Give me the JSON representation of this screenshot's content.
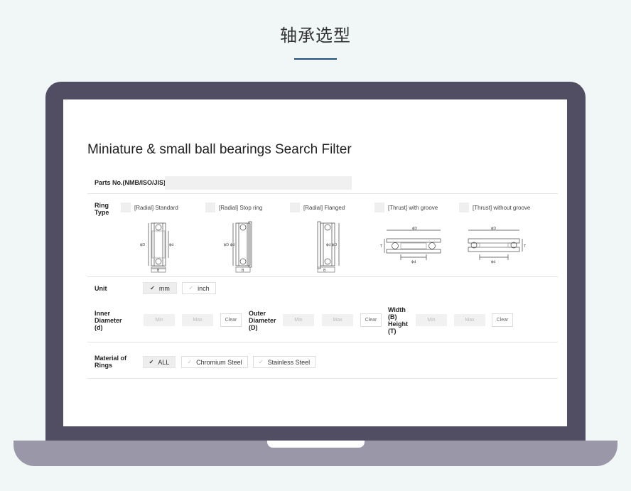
{
  "page_heading": "轴承选型",
  "filter": {
    "title": "Miniature & small ball bearings Search Filter",
    "parts_label": "Parts No.(NMB/ISO/JIS)",
    "parts_value": "",
    "ring_type_label": "Ring Type",
    "ring_types": [
      {
        "label": "[Radial] Standard",
        "icon": "radial-standard-bearing-diagram"
      },
      {
        "label": "[Radial] Stop ring",
        "icon": "radial-stop-ring-bearing-diagram"
      },
      {
        "label": "[Radial] Flanged",
        "icon": "radial-flanged-bearing-diagram"
      },
      {
        "label": "[Thrust] with groove",
        "icon": "thrust-with-groove-bearing-diagram"
      },
      {
        "label": "[Thrust] without groove",
        "icon": "thrust-without-groove-bearing-diagram"
      }
    ],
    "diagram_labels": {
      "phi_D": "ϕD",
      "phi_d": "ϕd",
      "phi_D_d": "ϕD ϕd",
      "phi_d_D": "ϕd ϕD",
      "B": "B",
      "T": "T"
    },
    "unit_label": "Unit",
    "units": [
      {
        "label": "mm",
        "selected": true
      },
      {
        "label": "inch",
        "selected": false
      }
    ],
    "inner_label": "Inner Diameter (d)",
    "outer_label": "Outer Diameter (D)",
    "width_label": "Width (B) Height (T)",
    "min_placeholder": "Min",
    "max_placeholder": "Max",
    "clear_label": "Clear",
    "material_label": "Material of Rings",
    "materials": [
      {
        "label": "ALL",
        "selected": true
      },
      {
        "label": "Chromium Steel",
        "selected": false
      },
      {
        "label": "Stainless Steel",
        "selected": false
      }
    ]
  },
  "colors": {
    "accent": "#1f4f7a",
    "laptop_lid": "#514d62",
    "laptop_base": "#9a98a8",
    "background": "#f1f6f7"
  }
}
